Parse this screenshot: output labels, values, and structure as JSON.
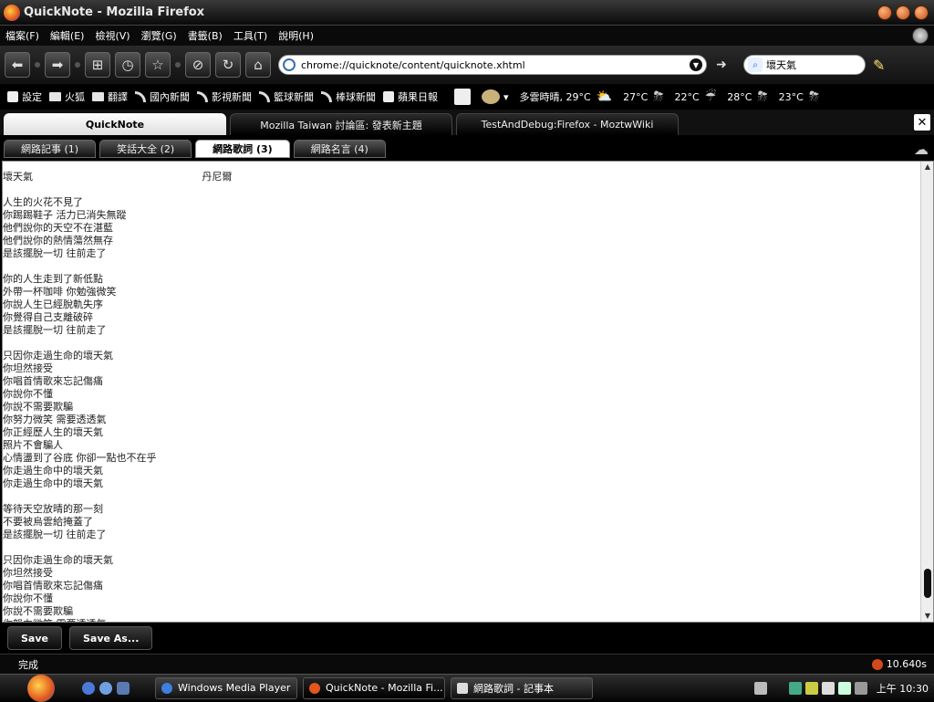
{
  "window": {
    "title": "QuickNote - Mozilla Firefox"
  },
  "menu": {
    "items": [
      "檔案(F)",
      "編輯(E)",
      "檢視(V)",
      "瀏覽(G)",
      "書籤(B)",
      "工具(T)",
      "說明(H)"
    ]
  },
  "nav": {
    "url": "chrome://quicknote/content/quicknote.xhtml",
    "search_value": "壞天氣"
  },
  "bookmarks": {
    "items": [
      {
        "label": "設定",
        "icon": "page-icon"
      },
      {
        "label": "火狐",
        "icon": "folder-icon"
      },
      {
        "label": "翻譯",
        "icon": "folder-icon"
      },
      {
        "label": "國內新聞",
        "icon": "rss-icon"
      },
      {
        "label": "影視新聞",
        "icon": "rss-icon"
      },
      {
        "label": "籃球新聞",
        "icon": "rss-icon"
      },
      {
        "label": "棒球新聞",
        "icon": "rss-icon"
      },
      {
        "label": "蘋果日報",
        "icon": "page-icon"
      }
    ]
  },
  "weather": {
    "current": "多雲時晴, 29°C",
    "forecast": [
      "27°C",
      "22°C",
      "28°C",
      "23°C"
    ]
  },
  "tabs": [
    {
      "label": "QuickNote",
      "active": true
    },
    {
      "label": "Mozilla Taiwan 討論區: 發表新主題",
      "active": false
    },
    {
      "label": "TestAndDebug:Firefox - MoztwWiki",
      "active": false
    }
  ],
  "quicknote": {
    "tabs": [
      {
        "label": "網路記事 (1)",
        "active": false
      },
      {
        "label": "笑話大全 (2)",
        "active": false
      },
      {
        "label": "網路歌詞 (3)",
        "active": true
      },
      {
        "label": "網路名言 (4)",
        "active": false
      }
    ],
    "content": "壞天氣                                                     丹尼爾\n\n人生的火花不見了\n你踢踢鞋子 活力已消失無蹤\n他們說你的天空不在湛藍\n他們說你的熱情蕩然無存\n是該擺脫一切 往前走了\n\n你的人生走到了新低點\n外帶一杯咖啡 你勉強微笑\n你說人生已經脫軌失序\n你覺得自己支離破碎\n是該擺脫一切 往前走了\n\n只因你走過生命的壞天氣\n你坦然接受\n你唱首情歌來忘記傷痛\n你說你不懂\n你說不需要欺騙\n你努力微笑 需要透透氣\n你正經歷人生的壞天氣\n照片不會騙人\n心情盪到了谷底 你卻一點也不在乎\n你走過生命中的壞天氣\n你走過生命中的壞天氣\n\n等待天空放晴的那一刻\n不要被烏雲給掩蓋了\n是該擺脫一切 往前走了\n\n只因你走過生命的壞天氣\n你坦然接受\n你唱首情歌來忘記傷痛\n你說你不懂\n你說不需要欺騙\n你努力微笑 需要透透氣",
    "save_label": "Save",
    "save_as_label": "Save As..."
  },
  "status": {
    "text": "完成",
    "timer": "10.640s"
  },
  "taskbar": {
    "items": [
      {
        "label": "Windows Media Player"
      },
      {
        "label": "QuickNote - Mozilla Fi..."
      },
      {
        "label": "網路歌詞 - 記事本"
      }
    ],
    "clock": "上午 10:30"
  }
}
